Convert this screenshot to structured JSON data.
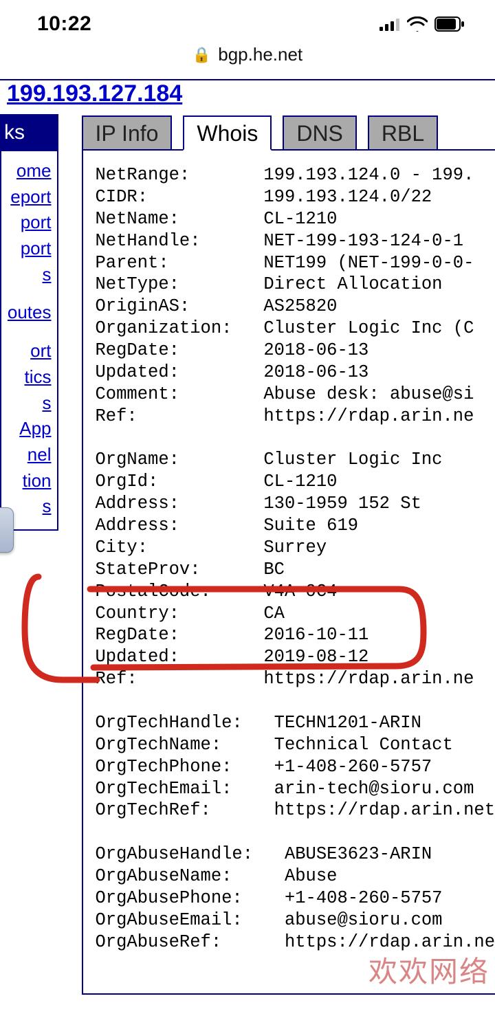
{
  "status": {
    "time": "10:22"
  },
  "url": {
    "host": "bgp.he.net"
  },
  "ip_link": "199.193.127.184",
  "sidebar": {
    "header": "ks",
    "items": [
      "ome",
      "eport",
      "port",
      "port",
      "s",
      "outes",
      "ort",
      "tics",
      "s",
      " App",
      "nel",
      "tion",
      "s"
    ]
  },
  "tabs": [
    "IP Info",
    "Whois",
    "DNS",
    "RBL"
  ],
  "active_tab_index": 1,
  "whois": {
    "block1": [
      [
        "NetRange:",
        "199.193.124.0 - 199."
      ],
      [
        "CIDR:",
        "199.193.124.0/22"
      ],
      [
        "NetName:",
        "CL-1210"
      ],
      [
        "NetHandle:",
        "NET-199-193-124-0-1"
      ],
      [
        "Parent:",
        "NET199 (NET-199-0-0-"
      ],
      [
        "NetType:",
        "Direct Allocation"
      ],
      [
        "OriginAS:",
        "AS25820"
      ],
      [
        "Organization:",
        "Cluster Logic Inc (C"
      ],
      [
        "RegDate:",
        "2018-06-13"
      ],
      [
        "Updated:",
        "2018-06-13"
      ],
      [
        "Comment:",
        "Abuse desk: abuse@si"
      ],
      [
        "Ref:",
        "https://rdap.arin.ne"
      ]
    ],
    "block2": [
      [
        "OrgName:",
        "Cluster Logic Inc"
      ],
      [
        "OrgId:",
        "CL-1210"
      ],
      [
        "Address:",
        "130-1959 152 St"
      ],
      [
        "Address:",
        "Suite 619"
      ],
      [
        "City:",
        "Surrey"
      ],
      [
        "StateProv:",
        "BC"
      ],
      [
        "PostalCode:",
        "V4A 0C4"
      ],
      [
        "Country:",
        "CA"
      ],
      [
        "RegDate:",
        "2016-10-11"
      ],
      [
        "Updated:",
        "2019-08-12"
      ],
      [
        "Ref:",
        "https://rdap.arin.ne"
      ]
    ],
    "block3": [
      [
        "OrgTechHandle:",
        "TECHN1201-ARIN"
      ],
      [
        "OrgTechName:",
        "Technical Contact"
      ],
      [
        "OrgTechPhone:",
        "+1-408-260-5757"
      ],
      [
        "OrgTechEmail:",
        "arin-tech@sioru.com"
      ],
      [
        "OrgTechRef:",
        "https://rdap.arin.net"
      ]
    ],
    "block4": [
      [
        "OrgAbuseHandle:",
        "ABUSE3623-ARIN"
      ],
      [
        "OrgAbuseName:",
        "Abuse"
      ],
      [
        "OrgAbusePhone:",
        "+1-408-260-5757"
      ],
      [
        "OrgAbuseEmail:",
        "abuse@sioru.com"
      ],
      [
        "OrgAbuseRef:",
        "https://rdap.arin.ne"
      ]
    ]
  },
  "watermark": "欢欢网络"
}
